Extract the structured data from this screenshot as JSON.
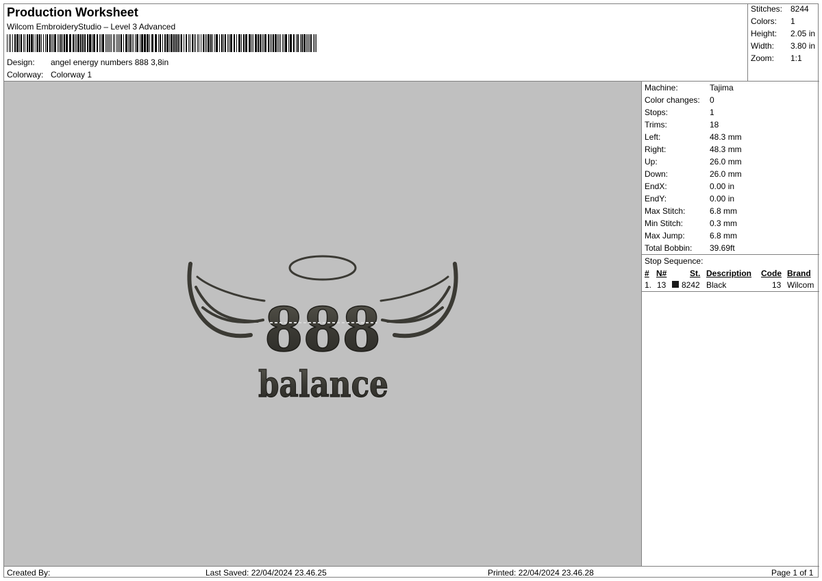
{
  "header": {
    "title": "Production Worksheet",
    "subtitle": "Wilcom EmbroideryStudio – Level 3 Advanced",
    "design_label": "Design:",
    "design_value": "angel energy numbers 888 3,8in",
    "colorway_label": "Colorway:",
    "colorway_value": "Colorway 1"
  },
  "summary": [
    {
      "label": "Stitches:",
      "value": "8244"
    },
    {
      "label": "Colors:",
      "value": "1"
    },
    {
      "label": "Height:",
      "value": "2.05 in"
    },
    {
      "label": "Width:",
      "value": "3.80 in"
    },
    {
      "label": "Zoom:",
      "value": "1:1"
    }
  ],
  "details": [
    {
      "label": "Machine:",
      "value": "Tajima"
    },
    {
      "label": "Color changes:",
      "value": "0"
    },
    {
      "label": "Stops:",
      "value": "1"
    },
    {
      "label": "Trims:",
      "value": "18"
    },
    {
      "label": "Left:",
      "value": "48.3 mm"
    },
    {
      "label": "Right:",
      "value": "48.3 mm"
    },
    {
      "label": "Up:",
      "value": "26.0 mm"
    },
    {
      "label": "Down:",
      "value": "26.0 mm"
    },
    {
      "label": "EndX:",
      "value": "0.00 in"
    },
    {
      "label": "EndY:",
      "value": "0.00 in"
    },
    {
      "label": "Max Stitch:",
      "value": "6.8 mm"
    },
    {
      "label": "Min Stitch:",
      "value": "0.3 mm"
    },
    {
      "label": "Max Jump:",
      "value": "6.8 mm"
    },
    {
      "label": "Total Bobbin:",
      "value": "39.69ft"
    }
  ],
  "stop_sequence": {
    "title": "Stop Sequence:",
    "columns": [
      "#",
      "N#",
      "St.",
      "Description",
      "Code",
      "Brand"
    ],
    "rows": [
      {
        "num": "1.",
        "n": "13",
        "color": "#1a1a1a",
        "st": "8242",
        "description": "Black",
        "code": "13",
        "brand": "Wilcom"
      }
    ]
  },
  "design_preview": {
    "digits": "888",
    "word": "balance",
    "thread_color": "#3b3a34"
  },
  "footer": {
    "created_by": "Created By:",
    "last_saved": "Last Saved: 22/04/2024 23.46.25",
    "printed": "Printed: 22/04/2024 23.46.28",
    "page": "Page 1 of 1"
  }
}
